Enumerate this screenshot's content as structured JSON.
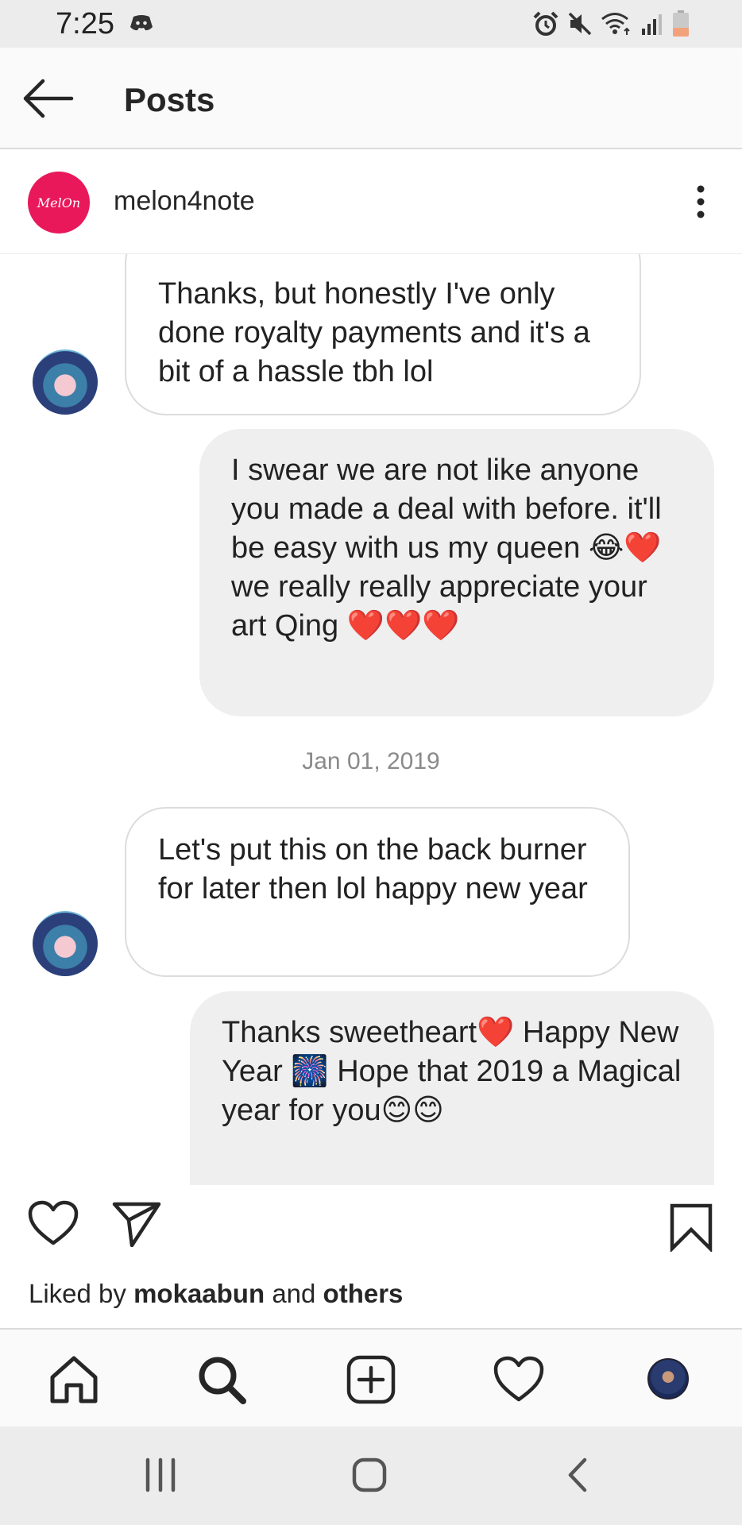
{
  "status_bar": {
    "time": "7:25",
    "icons": [
      "discord-icon",
      "alarm-icon",
      "mute-icon",
      "wifi-icon",
      "signal-icon",
      "battery-icon"
    ]
  },
  "header": {
    "title": "Posts"
  },
  "post": {
    "author": {
      "avatar_text": "MelOn",
      "username": "melon4note"
    },
    "chat": {
      "messages": [
        {
          "direction": "in",
          "text": "Thanks, but honestly I've only done royalty payments and it's a bit of a hassle tbh lol"
        },
        {
          "direction": "out",
          "text": "I swear we are not like anyone you made a deal with before. it'll be easy with us my queen 😂❤️ we really really appreciate your art Qing ❤️❤️❤️"
        },
        {
          "direction": "in",
          "text": "Let's put this on the back burner for later then lol happy new year"
        },
        {
          "direction": "out",
          "text": "Thanks sweetheart❤️ Happy New Year 🎆 Hope that 2019 a Magical year for you😊😊"
        }
      ],
      "date_label": "Jan 01, 2019"
    },
    "likes": {
      "prefix": "Liked by",
      "user": "mokaabun",
      "conjunction": "and",
      "others": "others"
    }
  },
  "bottom_nav": [
    "home-icon",
    "search-icon",
    "add-post-icon",
    "activity-heart-icon",
    "profile-avatar"
  ],
  "android_nav": [
    "recent-apps-button",
    "home-button",
    "back-button"
  ],
  "colors": {
    "brand_avatar": "#e8185b",
    "text": "#262626",
    "heart_red": "#e8303f"
  }
}
